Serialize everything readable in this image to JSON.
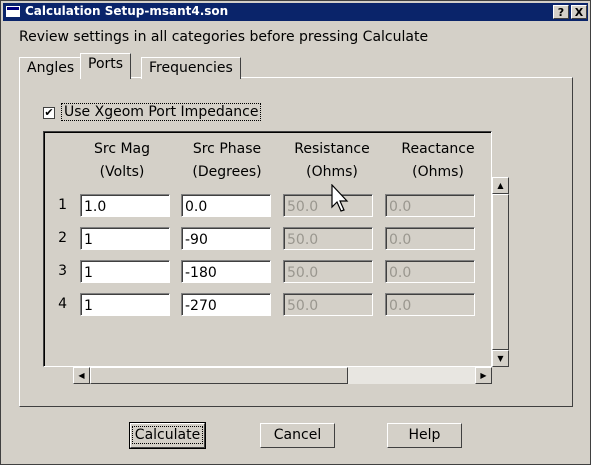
{
  "window": {
    "title": "Calculation Setup-msant4.son"
  },
  "titlebar_buttons": {
    "help": "?",
    "close": "X"
  },
  "instruction": "Review settings in all categories before pressing Calculate",
  "tabs": [
    {
      "label": "Angles",
      "active": false
    },
    {
      "label": "Ports",
      "active": true
    },
    {
      "label": "Frequencies",
      "active": false
    }
  ],
  "use_xgeom": {
    "label": "Use Xgeom Port Impedance",
    "checked": true,
    "mark": "✔"
  },
  "grid": {
    "columns": [
      {
        "line1": "Src Mag",
        "line2": "(Volts)"
      },
      {
        "line1": "Src Phase",
        "line2": "(Degrees)"
      },
      {
        "line1": "Resistance",
        "line2": "(Ohms)"
      },
      {
        "line1": "Reactance",
        "line2": "(Ohms)"
      }
    ],
    "rows": [
      {
        "num": "1",
        "mag": "1.0",
        "phase": "0.0",
        "resistance": "50.0",
        "reactance": "0.0"
      },
      {
        "num": "2",
        "mag": "1",
        "phase": "-90",
        "resistance": "50.0",
        "reactance": "0.0"
      },
      {
        "num": "3",
        "mag": "1",
        "phase": "-180",
        "resistance": "50.0",
        "reactance": "0.0"
      },
      {
        "num": "4",
        "mag": "1",
        "phase": "-270",
        "resistance": "50.0",
        "reactance": "0.0"
      }
    ]
  },
  "scroll_arrows": {
    "up": "▲",
    "down": "▼",
    "left": "◀",
    "right": "▶"
  },
  "buttons": {
    "calculate": "Calculate",
    "cancel": "Cancel",
    "help": "Help"
  }
}
